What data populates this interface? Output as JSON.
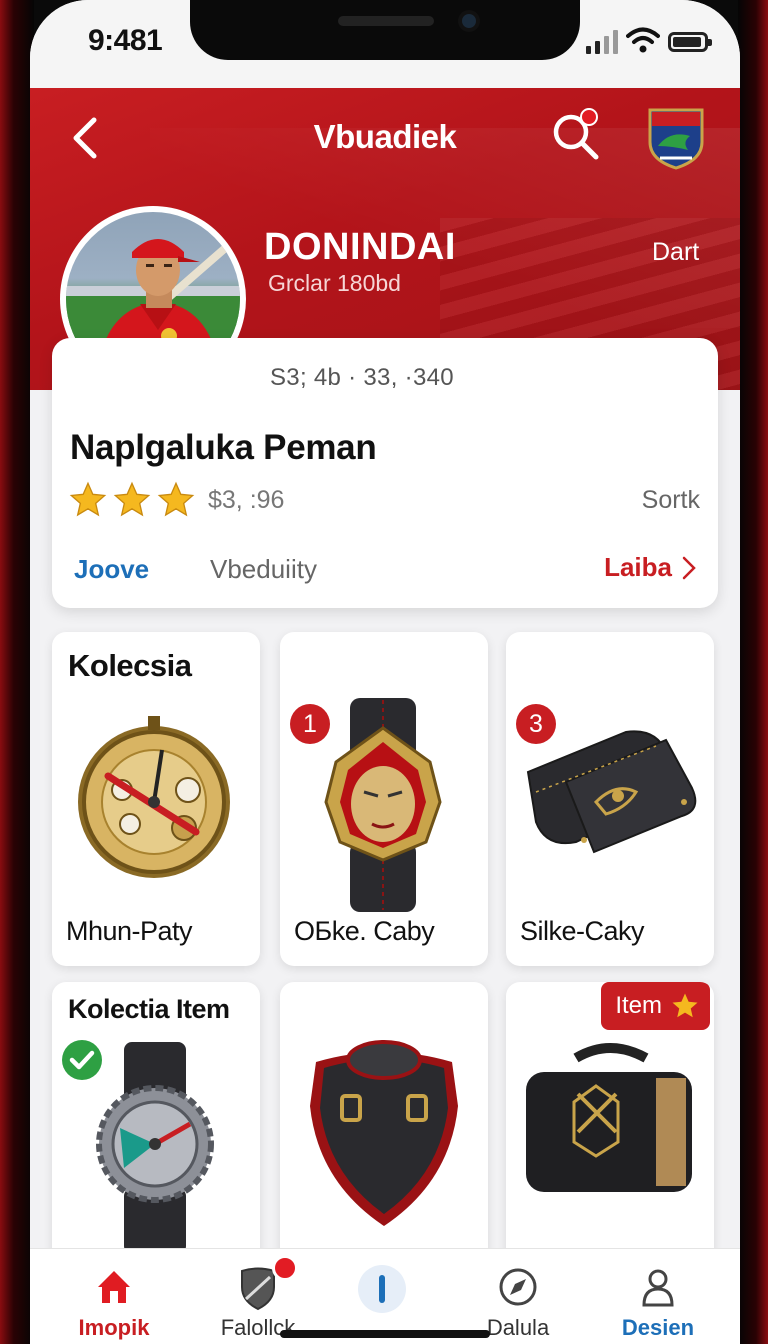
{
  "status": {
    "time": "9:481"
  },
  "header": {
    "title": "Vbuadiek",
    "player_name": "DONINDAI",
    "player_sub": "Grclar 180bd",
    "corner_text": "Dart"
  },
  "info_card": {
    "stats": "S3; 4b · 33, ·340",
    "title": "Naplgaluka Peman",
    "price": "$3, :96",
    "sort_label": "Sortk",
    "link_left": "Joove",
    "link_mid": "Vbeduiity",
    "link_right": "Laiba"
  },
  "grid": [
    {
      "heading": "Kolecsia",
      "label": "Mhun-Paty",
      "product": "compass-watch"
    },
    {
      "badge": "1",
      "label": "OБke. Caby",
      "product": "mask-watch"
    },
    {
      "badge": "3",
      "label": "Silke-Caky",
      "product": "leather-strap"
    },
    {
      "heading": "Kolectia Item",
      "product": "silver-watch"
    },
    {
      "product": "shield-collar"
    },
    {
      "pill": "Item",
      "product": "leather-case"
    }
  ],
  "tabbar": [
    {
      "label": "Imopik",
      "icon": "home-icon"
    },
    {
      "label": "Falollck",
      "icon": "shield-icon"
    },
    {
      "label": "",
      "icon": "center-icon"
    },
    {
      "label": "Dalula",
      "icon": "compass-icon"
    },
    {
      "label": "Desien",
      "icon": "person-icon"
    }
  ],
  "colors": {
    "brand": "#c81e22",
    "link": "#1d6fb8",
    "verified": "#2ea043"
  }
}
